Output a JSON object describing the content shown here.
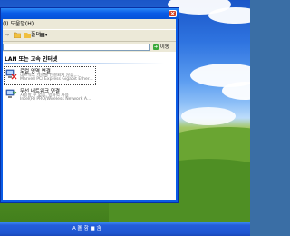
{
  "menubar": {
    "text": "(I)  도움말(H)"
  },
  "toolbar": {
    "back_label": "→",
    "folders_label": "폴더",
    "views_label": "▦▾"
  },
  "address": {
    "go_label": "이동"
  },
  "content": {
    "group_title": "LAN 또는 고속 인터넷",
    "connections": [
      {
        "name": "로컬 영역 연결",
        "status": "네트워크 케이블 연결되지 않음,...",
        "device": "Marvell PCI Express Gigabit Ether..."
      },
      {
        "name": "무선 네트워크 연결",
        "status": "사용할 수 없음, 방화벽 사용",
        "device": "Intel(R) PRO/Wireless Network A..."
      }
    ]
  },
  "taskbar": {
    "tray_text": "A 圖 함 ■ 含"
  },
  "colors": {
    "xp_blue": "#0a5ce6",
    "face": "#ece9d8",
    "taskbar": "#245edb",
    "close_red": "#d44020"
  }
}
